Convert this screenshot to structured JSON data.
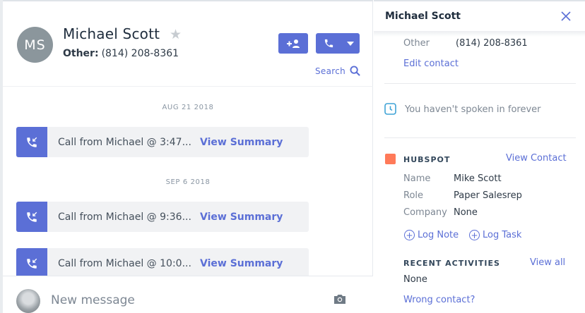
{
  "contact": {
    "initials": "MS",
    "name": "Michael Scott",
    "phone_label": "Other:",
    "phone": "(814) 208-8361"
  },
  "header": {
    "search_label": "Search"
  },
  "timeline": {
    "groups": [
      {
        "date": "AUG 21 2018",
        "calls": [
          {
            "text": "Call from Michael @ 3:47...",
            "link": "View Summary"
          }
        ]
      },
      {
        "date": "SEP 6 2018",
        "calls": [
          {
            "text": "Call from Michael @ 9:36...",
            "link": "View Summary"
          },
          {
            "text": "Call from Michael @ 10:0...",
            "link": "View Summary"
          }
        ]
      }
    ]
  },
  "composer": {
    "placeholder": "New message"
  },
  "panel": {
    "title": "Michael Scott",
    "phone_type": "Other",
    "phone": "(814) 208-8361",
    "edit_contact": "Edit contact",
    "last_spoken": "You haven't spoken in forever",
    "hubspot": {
      "heading": "HUBSPOT",
      "view_contact": "View Contact",
      "fields": [
        {
          "label": "Name",
          "value": "Mike Scott"
        },
        {
          "label": "Role",
          "value": "Paper Salesrep"
        },
        {
          "label": "Company",
          "value": "None"
        }
      ],
      "log_note": "Log Note",
      "log_task": "Log Task"
    },
    "recent": {
      "heading": "RECENT ACTIVITIES",
      "view_all": "View all",
      "value": "None"
    },
    "wrong_contact": "Wrong contact?"
  },
  "colors": {
    "accent": "#5b6fd6",
    "hubspot": "#ff7a59",
    "clock": "#3fa3d6"
  }
}
